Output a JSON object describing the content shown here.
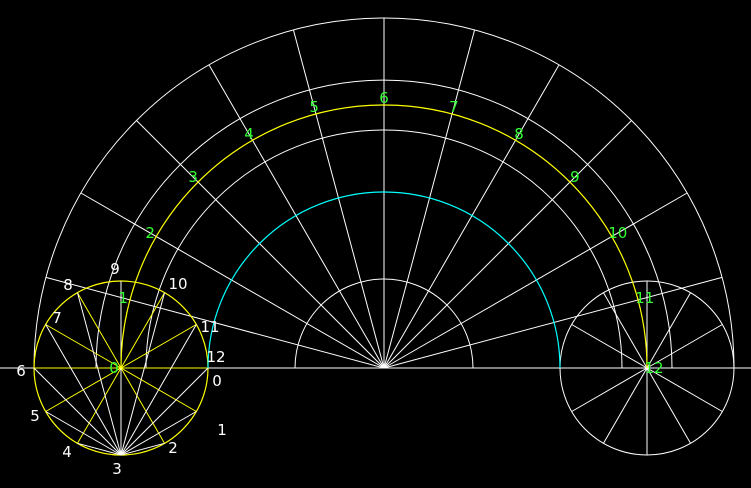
{
  "colors": {
    "background": "#000000",
    "construction": "#ffffff",
    "path": "#ffff00",
    "base": "#00ffff",
    "label_green": "#33ff33",
    "label_white": "#ffffff"
  },
  "center_labels": [
    "0",
    "1",
    "2",
    "3",
    "4",
    "5",
    "6",
    "7",
    "8",
    "9",
    "10",
    "11",
    "12"
  ],
  "left_circle_labels": [
    "0",
    "1",
    "2",
    "3",
    "4",
    "5",
    "6",
    "7",
    "8",
    "9",
    "10",
    "11",
    "12"
  ]
}
